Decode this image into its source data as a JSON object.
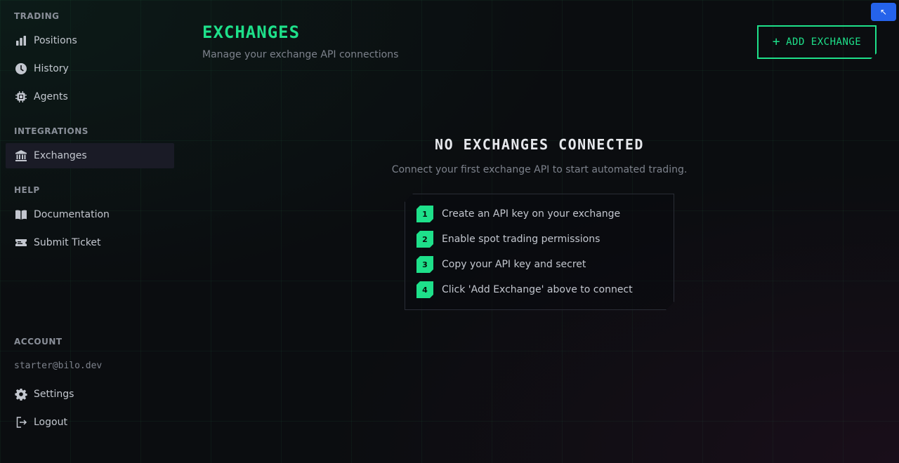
{
  "sidebar": {
    "trading_label": "TRADING",
    "trading_items": [
      {
        "label": "Positions",
        "icon": "bar-chart-icon"
      },
      {
        "label": "History",
        "icon": "clock-icon"
      },
      {
        "label": "Agents",
        "icon": "cpu-icon"
      }
    ],
    "integrations_label": "INTEGRATIONS",
    "integrations_items": [
      {
        "label": "Exchanges",
        "icon": "bank-icon",
        "active": true
      }
    ],
    "help_label": "HELP",
    "help_items": [
      {
        "label": "Documentation",
        "icon": "book-icon"
      },
      {
        "label": "Submit Ticket",
        "icon": "ticket-icon"
      }
    ],
    "account_label": "ACCOUNT",
    "account_email": "starter@bilo.dev",
    "account_items": [
      {
        "label": "Settings",
        "icon": "gear-icon"
      },
      {
        "label": "Logout",
        "icon": "logout-icon"
      }
    ]
  },
  "header": {
    "title": "EXCHANGES",
    "subtitle": "Manage your exchange API connections",
    "add_button_label": "ADD EXCHANGE",
    "add_button_icon": "plus-icon"
  },
  "corner_button": {
    "icon": "arrow-up-left-icon",
    "glyph": "↖"
  },
  "empty_state": {
    "title": "NO EXCHANGES CONNECTED",
    "description": "Connect your first exchange API to start automated trading.",
    "steps": [
      {
        "num": "1",
        "text": "Create an API key on your exchange"
      },
      {
        "num": "2",
        "text": "Enable spot trading permissions"
      },
      {
        "num": "3",
        "text": "Copy your API key and secret"
      },
      {
        "num": "4",
        "text": "Click 'Add Exchange' above to connect"
      }
    ]
  },
  "colors": {
    "accent": "#1ee08a",
    "background": "#0b0d10",
    "active_nav": "#1a1b26",
    "corner_button": "#2563eb"
  }
}
